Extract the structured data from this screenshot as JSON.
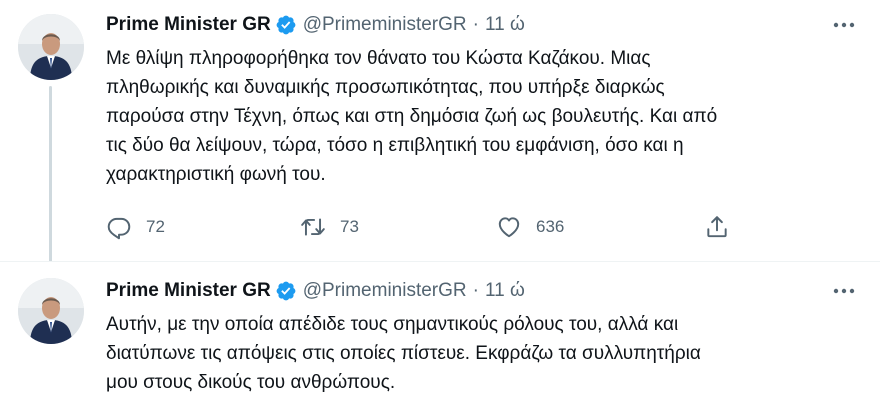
{
  "tweets": [
    {
      "author_name": "Prime Minister GR",
      "handle": "@PrimeministerGR",
      "separator": "·",
      "time": "11 ώ",
      "lines": [
        "Με θλίψη πληροφορήθηκα τον θάνατο του Κώστα Καζάκου. Μιας",
        "πληθωρικής και δυναμικής προσωπικότητας, που υπήρξε διαρκώς",
        "παρούσα στην Τέχνη, όπως και στη δημόσια ζωή ως βουλευτής. Και από",
        "τις δύο θα λείψουν, τώρα, τόσο η επιβλητική του εμφάνιση, όσο και η",
        "χαρακτηριστική φωνή του."
      ],
      "replies": "72",
      "retweets": "73",
      "likes": "636"
    },
    {
      "author_name": "Prime Minister GR",
      "handle": "@PrimeministerGR",
      "separator": "·",
      "time": "11 ώ",
      "lines": [
        "Αυτήν, με την οποία απέδιδε τους σημαντικούς ρόλους του, αλλά και",
        "διατύπωνε τις απόψεις στις οποίες πίστευε. Εκφράζω τα συλλυπητήρια",
        "μου στους δικούς του ανθρώπους."
      ]
    }
  ],
  "icons": {
    "verified": "verified-badge-icon",
    "more": "more-icon",
    "reply": "reply-icon",
    "retweet": "retweet-icon",
    "like": "like-icon",
    "share": "share-icon"
  },
  "colors": {
    "verified": "#1d9bf0",
    "secondary_text": "#536471",
    "primary_text": "#0f1419",
    "thread_line": "#cfd9de"
  }
}
